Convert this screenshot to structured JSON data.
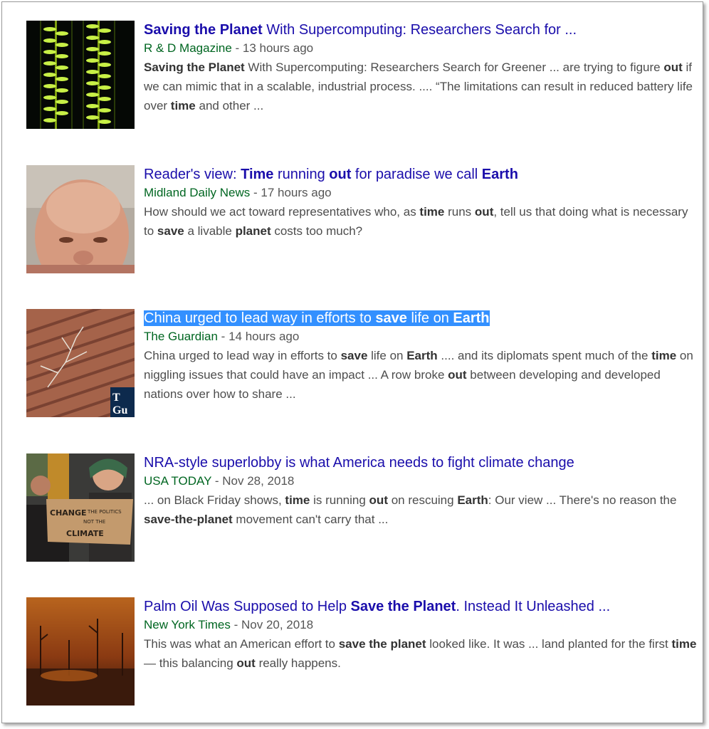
{
  "results": [
    {
      "title": [
        {
          "t": "Saving the Planet",
          "b": true
        },
        {
          "t": " With Supercomputing: Researchers Search for ...",
          "b": false
        }
      ],
      "source": "R & D Magazine",
      "separator": " - ",
      "date": "13 hours ago",
      "snippet": [
        {
          "t": "Saving the Planet",
          "b": true
        },
        {
          "t": " With Supercomputing: Researchers Search for Greener ... are trying to figure ",
          "b": false
        },
        {
          "t": "out",
          "b": true
        },
        {
          "t": " if we can mimic that in a scalable, industrial process. .... “The limitations can result in reduced battery life over ",
          "b": false
        },
        {
          "t": "time",
          "b": true
        },
        {
          "t": " and other ...",
          "b": false
        }
      ],
      "thumbnail": "green-fibers-image",
      "selected": false
    },
    {
      "title": [
        {
          "t": "Reader's view: ",
          "b": false
        },
        {
          "t": "Time",
          "b": true
        },
        {
          "t": " running ",
          "b": false
        },
        {
          "t": "out",
          "b": true
        },
        {
          "t": " for paradise we call ",
          "b": false
        },
        {
          "t": "Earth",
          "b": true
        }
      ],
      "source": "Midland Daily News",
      "separator": " - ",
      "date": "17 hours ago",
      "snippet": [
        {
          "t": "How should we act toward representatives who, as ",
          "b": false
        },
        {
          "t": "time",
          "b": true
        },
        {
          "t": " runs ",
          "b": false
        },
        {
          "t": "out",
          "b": true
        },
        {
          "t": ", tell us that doing what is necessary to ",
          "b": false
        },
        {
          "t": "save",
          "b": true
        },
        {
          "t": " a livable ",
          "b": false
        },
        {
          "t": "planet",
          "b": true
        },
        {
          "t": " costs too much?",
          "b": false
        }
      ],
      "thumbnail": "bald-man-portrait",
      "selected": false
    },
    {
      "title": [
        {
          "t": "China urged to lead way in efforts to ",
          "b": false
        },
        {
          "t": "save",
          "b": true
        },
        {
          "t": " life on ",
          "b": false
        },
        {
          "t": "Earth",
          "b": true
        }
      ],
      "source": "The Guardian",
      "separator": " - ",
      "date": "14 hours ago",
      "snippet": [
        {
          "t": "China urged to lead way in efforts to ",
          "b": false
        },
        {
          "t": "save",
          "b": true
        },
        {
          "t": " life on ",
          "b": false
        },
        {
          "t": "Earth",
          "b": true
        },
        {
          "t": " .... and its diplomats spent much of the ",
          "b": false
        },
        {
          "t": "time",
          "b": true
        },
        {
          "t": " on niggling issues that could have an impact ... A row broke ",
          "b": false
        },
        {
          "t": "out",
          "b": true
        },
        {
          "t": " between developing and developed nations over how to share ...",
          "b": false
        }
      ],
      "thumbnail": "dry-tree-aerial-image",
      "thumbnail_text": "The Gu",
      "selected": true
    },
    {
      "title": [
        {
          "t": "NRA-style superlobby is what America needs to fight climate change",
          "b": false
        }
      ],
      "source": "USA TODAY",
      "separator": " - ",
      "date": "Nov 28, 2018",
      "snippet": [
        {
          "t": "... on Black Friday shows, ",
          "b": false
        },
        {
          "t": "time",
          "b": true
        },
        {
          "t": " is running ",
          "b": false
        },
        {
          "t": "out",
          "b": true
        },
        {
          "t": " on rescuing ",
          "b": false
        },
        {
          "t": "Earth",
          "b": true
        },
        {
          "t": ": Our view ... There's no reason the ",
          "b": false
        },
        {
          "t": "save-the-planet",
          "b": true
        },
        {
          "t": " movement can't carry that ...",
          "b": false
        }
      ],
      "thumbnail": "climate-protest-image",
      "thumbnail_sign_text": [
        "CHANGE",
        "THE POLITICS",
        "NOT THE",
        "CLIMATE"
      ],
      "selected": false
    },
    {
      "title": [
        {
          "t": "Palm Oil Was Supposed to Help ",
          "b": false
        },
        {
          "t": "Save the Planet",
          "b": true
        },
        {
          "t": ". Instead It Unleashed ...",
          "b": false
        }
      ],
      "source": "New York Times",
      "separator": " - ",
      "date": "Nov 20, 2018",
      "snippet": [
        {
          "t": "This was what an American effort to ",
          "b": false
        },
        {
          "t": "save the planet",
          "b": true
        },
        {
          "t": " looked like. It was ... land planted for the first ",
          "b": false
        },
        {
          "t": "time",
          "b": true
        },
        {
          "t": " — this balancing ",
          "b": false
        },
        {
          "t": "out",
          "b": true
        },
        {
          "t": " really happens.",
          "b": false
        }
      ],
      "thumbnail": "burning-forest-image",
      "selected": false
    }
  ],
  "colors": {
    "title_link": "#1a0dab",
    "source_green": "#006621",
    "date_gray": "#555555",
    "snippet_gray": "#4d4d4d",
    "selection_blue": "#3390ff"
  }
}
